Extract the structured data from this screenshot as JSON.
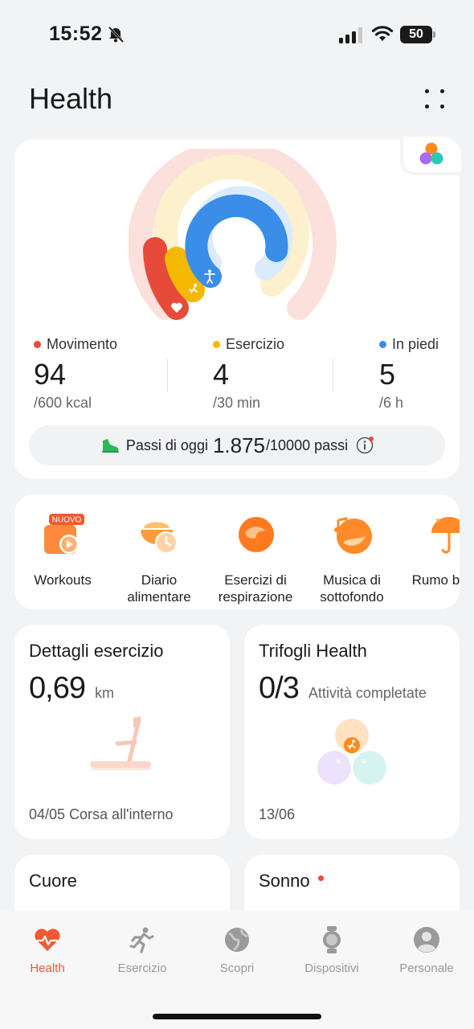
{
  "status_bar": {
    "time": "15:52",
    "battery": "50"
  },
  "header": {
    "title": "Health"
  },
  "metrics": [
    {
      "label": "Movimento",
      "value": "94",
      "goal": "/600 kcal",
      "color": "#e84a3a"
    },
    {
      "label": "Esercizio",
      "value": "4",
      "goal": "/30 min",
      "color": "#f5b800"
    },
    {
      "label": "In piedi",
      "value": "5",
      "goal": "/6 h",
      "color": "#3a8ee8"
    }
  ],
  "steps": {
    "prefix": "Passi di oggi",
    "count": "1.875",
    "goal": "/10000 passi"
  },
  "shortcuts": [
    {
      "label": "Workouts",
      "badge": "NUOVO",
      "icon": "workouts-icon"
    },
    {
      "label": "Diario alimentare",
      "icon": "food-diary-icon"
    },
    {
      "label": "Esercizi di respirazione",
      "icon": "breathing-icon"
    },
    {
      "label": "Musica di sottofondo",
      "icon": "music-icon"
    },
    {
      "label": "Rumo bianc",
      "icon": "white-noise-icon"
    }
  ],
  "exercise_details": {
    "title": "Dettagli esercizio",
    "value": "0,69",
    "unit": "km",
    "date": "04/05 Corsa all'interno"
  },
  "health_clovers": {
    "title": "Trifogli Health",
    "value": "0/3",
    "unit": "Attività completate",
    "date": "13/06"
  },
  "heart": {
    "title": "Cuore"
  },
  "sleep": {
    "title": "Sonno"
  },
  "bottom_nav": [
    {
      "label": "Health",
      "icon": "heart-pulse-icon",
      "active": true
    },
    {
      "label": "Esercizio",
      "icon": "running-icon",
      "active": false
    },
    {
      "label": "Scopri",
      "icon": "globe-icon",
      "active": false
    },
    {
      "label": "Dispositivi",
      "icon": "watch-icon",
      "active": false
    },
    {
      "label": "Personale",
      "icon": "person-icon",
      "active": false
    }
  ]
}
